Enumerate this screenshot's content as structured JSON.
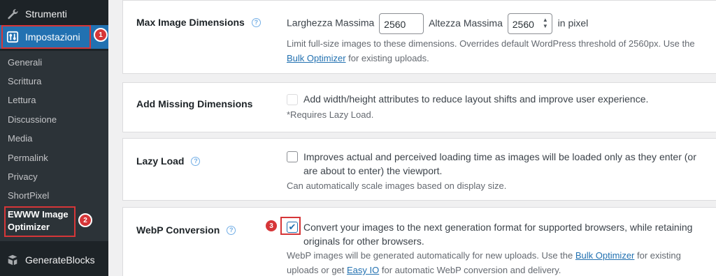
{
  "sidebar": {
    "tools": {
      "label": "Strumenti",
      "icon": "wrench-icon"
    },
    "settings": {
      "label": "Impostazioni",
      "icon": "settings-sliders-icon"
    },
    "submenu": [
      "Generali",
      "Scrittura",
      "Lettura",
      "Discussione",
      "Media",
      "Permalink",
      "Privacy",
      "ShortPixel"
    ],
    "current_submenu": "EWWW Image Optimizer",
    "generateblocks": {
      "label": "GenerateBlocks",
      "icon": "generateblocks-icon"
    }
  },
  "badges": [
    "1",
    "2",
    "3"
  ],
  "settings": {
    "max_dim": {
      "title": "Max Image Dimensions",
      "width_label": "Larghezza Massima",
      "width_value": "2560",
      "height_label": "Altezza Massima",
      "height_value": "2560",
      "unit": "in pixel",
      "desc_pre": "Limit full-size images to these dimensions. Overrides default WordPress threshold of 2560px. Use the ",
      "desc_link": "Bulk Optimizer",
      "desc_post": " for existing uploads."
    },
    "missing_dim": {
      "title": "Add Missing Dimensions",
      "label": "Add width/height attributes to reduce layout shifts and improve user experience.",
      "note": "*Requires Lazy Load."
    },
    "lazy": {
      "title": "Lazy Load",
      "label": "Improves actual and perceived loading time as images will be loaded only as they enter (or are about to enter) the viewport.",
      "desc": "Can automatically scale images based on display size."
    },
    "webp": {
      "title": "WebP Conversion",
      "label": "Convert your images to the next generation format for supported browsers, while retaining originals for other browsers.",
      "desc_pre": "WebP images will be generated automatically for new uploads. Use the ",
      "desc_link1": "Bulk Optimizer",
      "desc_mid": " for existing uploads or get ",
      "desc_link2": "Easy IO",
      "desc_post": " for automatic WebP conversion and delivery."
    }
  },
  "colors": {
    "accent": "#2271b1",
    "highlight": "#d63638",
    "sidebar": "#1d2327"
  }
}
